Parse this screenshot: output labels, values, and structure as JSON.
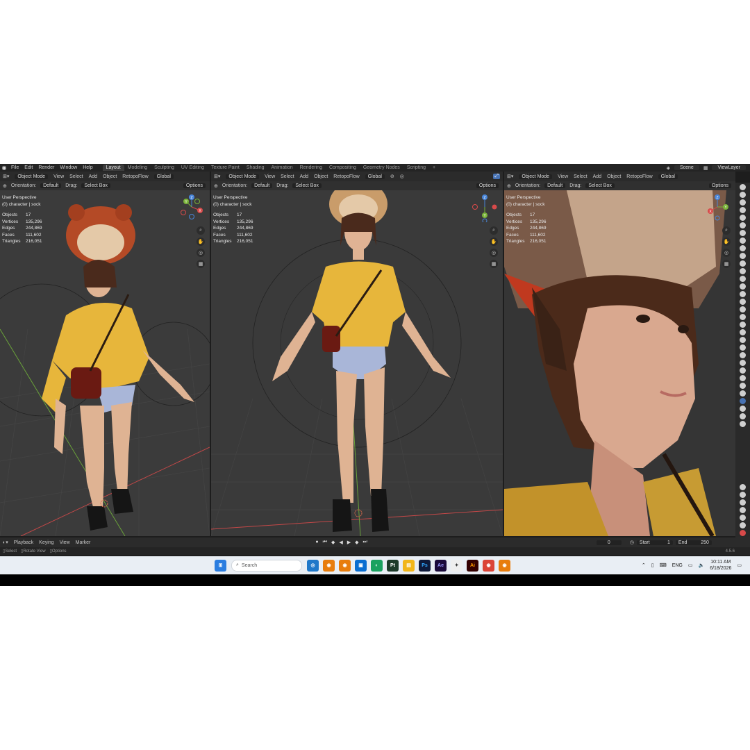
{
  "topbar": {
    "menu": [
      "File",
      "Edit",
      "Render",
      "Window",
      "Help"
    ],
    "workspaces": [
      "Layout",
      "Modeling",
      "Sculpting",
      "UV Editing",
      "Texture Paint",
      "Shading",
      "Animation",
      "Rendering",
      "Compositing",
      "Geometry Nodes",
      "Scripting"
    ],
    "active_workspace": "Layout",
    "scene": "Scene",
    "view_layer": "ViewLayer"
  },
  "viewports": [
    {
      "mode": "Object Mode",
      "menu": [
        "View",
        "Select",
        "Add",
        "Object"
      ],
      "addon": "RetopoFlow",
      "transform": "Global",
      "orientation_label": "Orientation:",
      "orientation": "Default",
      "drag_label": "Drag:",
      "drag": "Select Box",
      "options": "Options",
      "view_name": "User Perspective",
      "collection": "(0) character | sock",
      "stats": [
        [
          "Objects",
          "17"
        ],
        [
          "Vertices",
          "135,296"
        ],
        [
          "Edges",
          "244,869"
        ],
        [
          "Faces",
          "111,602"
        ],
        [
          "Triangles",
          "216,051"
        ]
      ]
    },
    {
      "mode": "Object Mode",
      "menu": [
        "View",
        "Select",
        "Add",
        "Object"
      ],
      "addon": "RetopoFlow",
      "transform": "Global",
      "orientation_label": "Orientation:",
      "orientation": "Default",
      "drag_label": "Drag:",
      "drag": "Select Box",
      "options": "Options",
      "view_name": "User Perspective",
      "collection": "(0) character | sock",
      "stats": [
        [
          "Objects",
          "17"
        ],
        [
          "Vertices",
          "135,296"
        ],
        [
          "Edges",
          "244,869"
        ],
        [
          "Faces",
          "111,602"
        ],
        [
          "Triangles",
          "216,051"
        ]
      ]
    },
    {
      "mode": "Object Mode",
      "menu": [
        "View",
        "Select",
        "Add",
        "Object"
      ],
      "addon": "RetopoFlow",
      "transform": "Global",
      "orientation_label": "Orientation:",
      "orientation": "Default",
      "drag_label": "Drag:",
      "drag": "Select Box",
      "options": "Options",
      "view_name": "User Perspective",
      "collection": "(0) character | sock",
      "stats": [
        [
          "Objects",
          "17"
        ],
        [
          "Vertices",
          "135,296"
        ],
        [
          "Edges",
          "244,869"
        ],
        [
          "Faces",
          "111,602"
        ],
        [
          "Triangles",
          "216,051"
        ]
      ]
    }
  ],
  "gizmo_axes": {
    "x": "X",
    "y": "Y",
    "z": "Z"
  },
  "timeline": {
    "menu": [
      "Playback",
      "Keying",
      "View",
      "Marker"
    ],
    "current_frame": "0",
    "start_label": "Start",
    "start": "1",
    "end_label": "End",
    "end": "250"
  },
  "status": {
    "select": "Select",
    "rotate": "Rotate View",
    "options": "Options",
    "version": "4.5.6"
  },
  "taskbar": {
    "search_placeholder": "Search",
    "apps": [
      "Pt",
      "Ps",
      "Ae",
      "Ai"
    ],
    "language": "ENG",
    "time": "10:11 AM",
    "date": "6/18/2026"
  },
  "colors": {
    "accent": "#4772b3",
    "blender_bg": "#3a3a3a",
    "skin": "#e0b394",
    "shirt": "#e8b840",
    "shorts": "#a9b6d8"
  }
}
